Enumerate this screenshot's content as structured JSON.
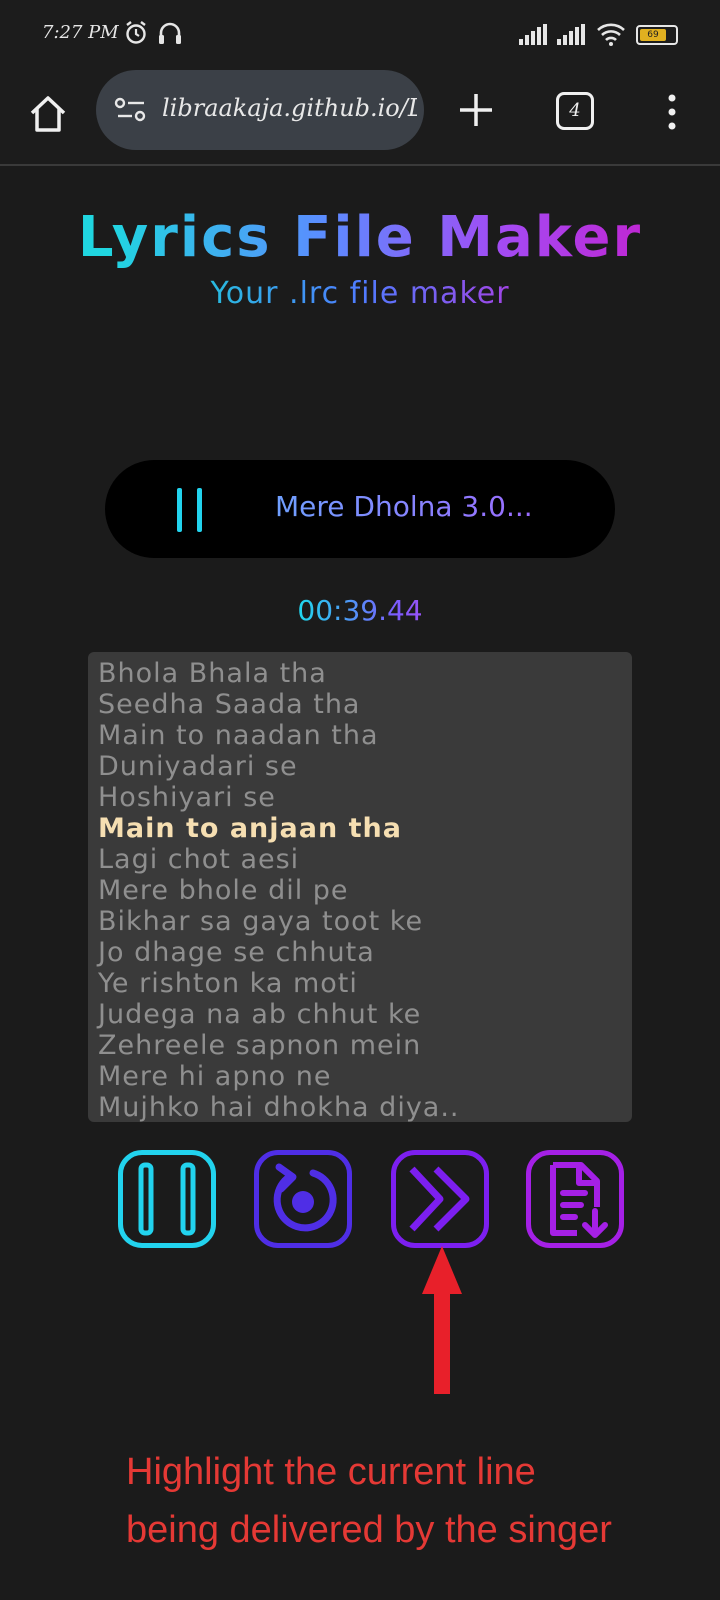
{
  "status_bar": {
    "time": "7:27 PM",
    "battery_level": "69",
    "icons": [
      "alarm-icon",
      "headphones-icon",
      "signal-icon",
      "signal-icon",
      "wifi-icon",
      "battery-icon"
    ]
  },
  "browser": {
    "url": "libraakaja.github.io/Lyrics-File-Maker",
    "tab_count": "4"
  },
  "app": {
    "title": "Lyrics File Maker",
    "subtitle": "Your .lrc file maker"
  },
  "player": {
    "song_title": "Mere Dholna 3.0...",
    "current_time": "00:39.44"
  },
  "lyrics": {
    "current_index": 5,
    "lines": [
      "Bhola Bhala tha",
      "Seedha Saada tha",
      "Main to naadan tha",
      "Duniyadari se",
      "Hoshiyari se",
      "Main to anjaan tha",
      "Lagi chot aesi",
      "Mere bhole dil pe",
      "Bikhar sa gaya toot ke",
      "Jo dhage se chhuta",
      "Ye rishton ka moti",
      "Judega na ab chhut ke",
      "Zehreele sapnon mein",
      "Mere hi apno ne",
      "Mujhko hai dhokha diya.."
    ]
  },
  "controls": {
    "pause_icon": "pause-icon",
    "restart_icon": "restart-icon",
    "next_icon": "chevron-right-icon",
    "download_icon": "file-download-icon"
  },
  "annotation": {
    "line1": "Highlight the current line",
    "line2": "being delivered by the singer"
  },
  "colors": {
    "cyan": "#22d3ee",
    "indigo": "#4f2ee6",
    "violet": "#7c1ff0",
    "purple": "#a520e6",
    "highlight": "#f6dfb2",
    "annotation_red": "#e53935"
  }
}
